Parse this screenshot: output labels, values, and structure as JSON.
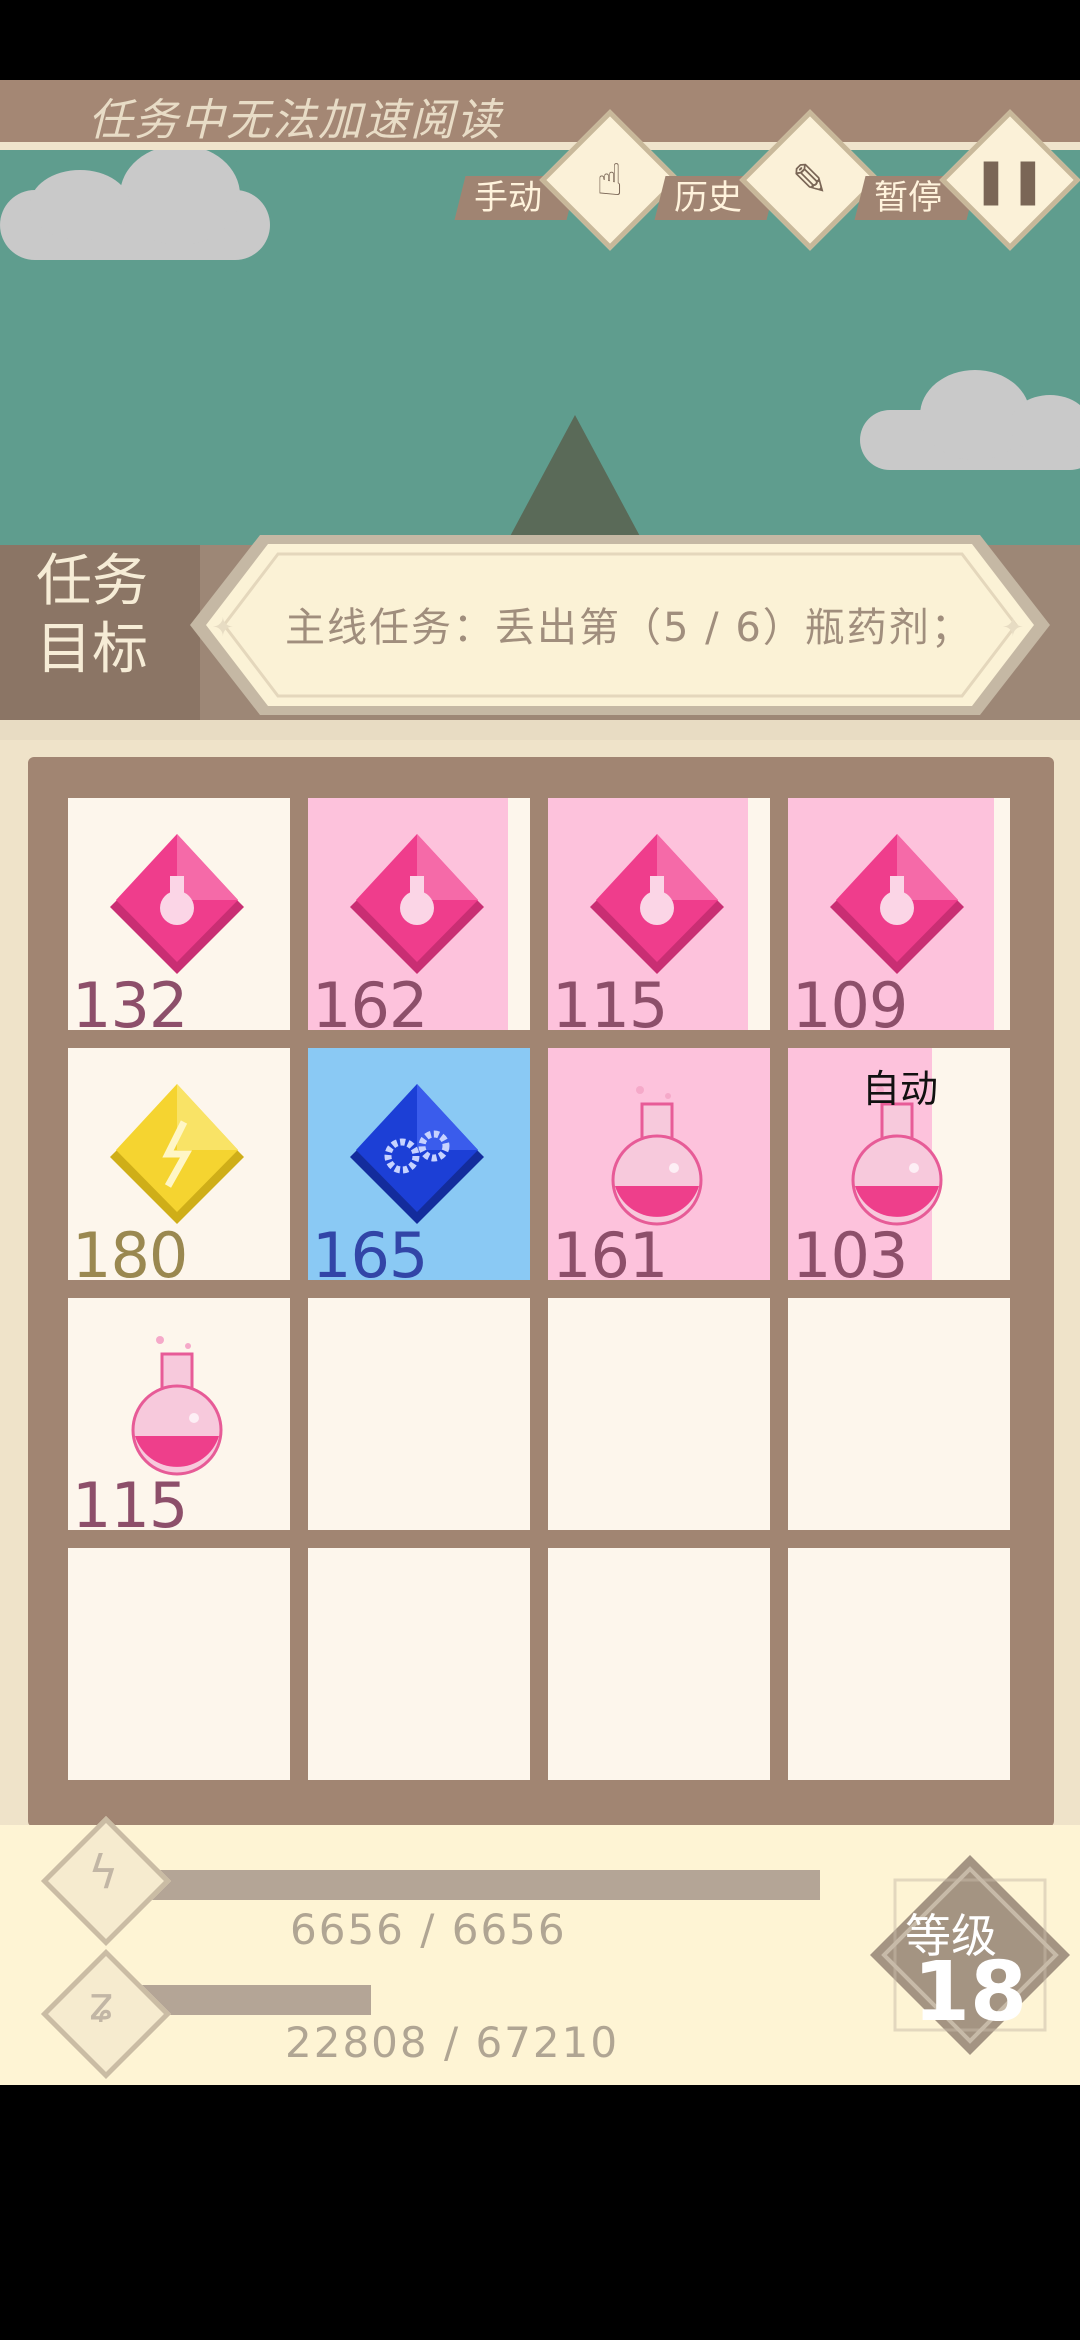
{
  "banner": {
    "notice": "任务中无法加速阅读"
  },
  "controls": [
    {
      "label": "手动",
      "icon": "hand-swipe-icon"
    },
    {
      "label": "历史",
      "icon": "feather-icon"
    },
    {
      "label": "暂停",
      "icon": "pause-icon"
    }
  ],
  "task": {
    "side_label_line1": "任务",
    "side_label_line2": "目标",
    "text": "主线任务：丢出第（5 / 6）瓶药剂；"
  },
  "board": {
    "cells": [
      {
        "row": 0,
        "col": 0,
        "item": "pink-potion-gem",
        "count": "132",
        "bg": "white",
        "fill_fraction": 0.0
      },
      {
        "row": 0,
        "col": 1,
        "item": "pink-potion-gem",
        "count": "162",
        "bg": "pink",
        "fill_fraction": 0.9
      },
      {
        "row": 0,
        "col": 2,
        "item": "pink-potion-gem",
        "count": "115",
        "bg": "pink",
        "fill_fraction": 0.9
      },
      {
        "row": 0,
        "col": 3,
        "item": "pink-potion-gem",
        "count": "109",
        "bg": "pink",
        "fill_fraction": 0.93
      },
      {
        "row": 1,
        "col": 0,
        "item": "yellow-lightning-gem",
        "count": "180",
        "bg": "white",
        "fill_fraction": 0.0
      },
      {
        "row": 1,
        "col": 1,
        "item": "blue-gear-gem",
        "count": "165",
        "bg": "blue",
        "fill_fraction": 1.0
      },
      {
        "row": 1,
        "col": 2,
        "item": "pink-flask",
        "count": "161",
        "bg": "pink",
        "fill_fraction": 1.0
      },
      {
        "row": 1,
        "col": 3,
        "item": "pink-flask",
        "count": "103",
        "bg": "pink",
        "fill_fraction": 0.65,
        "tag": "自动"
      },
      {
        "row": 2,
        "col": 0,
        "item": "pink-flask",
        "count": "115",
        "bg": "white",
        "fill_fraction": 0.0
      },
      {
        "row": 2,
        "col": 1,
        "item": "",
        "count": "",
        "bg": "white"
      },
      {
        "row": 2,
        "col": 2,
        "item": "",
        "count": "",
        "bg": "white"
      },
      {
        "row": 2,
        "col": 3,
        "item": "",
        "count": "",
        "bg": "white"
      },
      {
        "row": 3,
        "col": 0,
        "item": "",
        "count": "",
        "bg": "white"
      },
      {
        "row": 3,
        "col": 1,
        "item": "",
        "count": "",
        "bg": "white"
      },
      {
        "row": 3,
        "col": 2,
        "item": "",
        "count": "",
        "bg": "white"
      },
      {
        "row": 3,
        "col": 3,
        "item": "",
        "count": "",
        "bg": "white"
      }
    ]
  },
  "stats": {
    "energy": {
      "icon": "lightning-icon",
      "text": "6656 / 6656",
      "fraction": 1.0
    },
    "exp": {
      "icon": "zigzag-icon",
      "text": "22808 / 67210",
      "fraction": 0.339
    }
  },
  "level": {
    "label": "等级",
    "value": "18"
  },
  "colors": {
    "sky": "#5f9d8e",
    "pink_gem": "#ef3d8c",
    "yellow_gem": "#f5d430",
    "blue_gem": "#1c3fd6",
    "board": "#a18572"
  }
}
